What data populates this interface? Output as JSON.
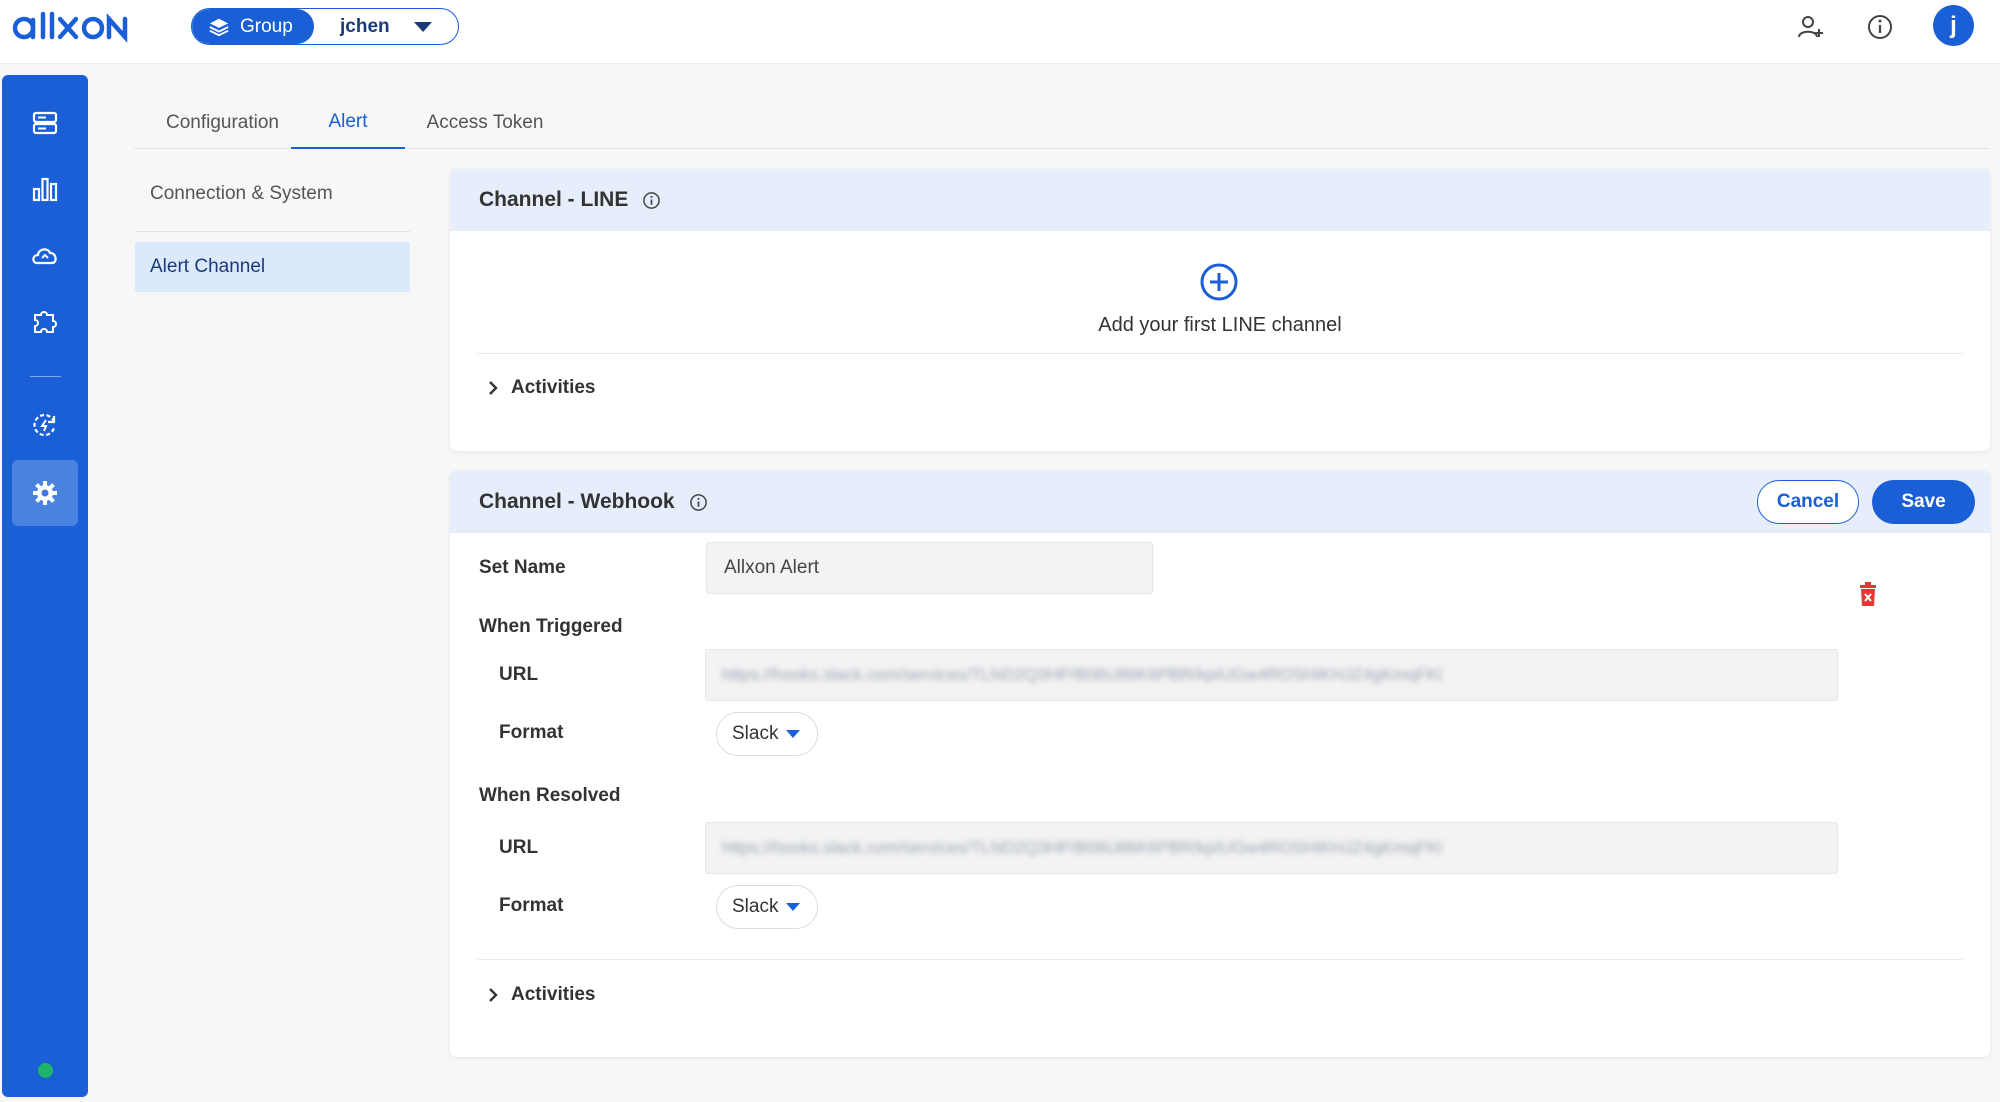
{
  "header": {
    "logo_text": "allxon",
    "group_label": "Group",
    "user_name": "jchen",
    "avatar_letter": "j",
    "icons": [
      "add-user-icon",
      "info-icon"
    ]
  },
  "rail": {
    "icons": [
      "server-icon",
      "bar-chart-icon",
      "cloud-sync-icon",
      "puzzle-icon",
      "refresh-icon",
      "gear-icon"
    ],
    "active": "gear-icon",
    "status_color": "#1fb46a"
  },
  "tabs": [
    {
      "label": "Configuration"
    },
    {
      "label": "Alert"
    },
    {
      "label": "Access Token"
    }
  ],
  "subnav": [
    {
      "label": "Connection & System"
    },
    {
      "label": "Alert Channel"
    }
  ],
  "line_card": {
    "title": "Channel - LINE",
    "add_text": "Add your first LINE channel",
    "activities": "Activities"
  },
  "webhook_card": {
    "title": "Channel - Webhook",
    "cancel": "Cancel",
    "save": "Save",
    "set_name_label": "Set Name",
    "set_name_value": "Allxon Alert",
    "triggered_label": "When Triggered",
    "resolved_label": "When Resolved",
    "url_label": "URL",
    "format_label": "Format",
    "triggered_url": "https://hooks.slack.com/services/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",
    "triggered_format": "Slack",
    "resolved_url": "https://hooks.slack.com/services/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",
    "resolved_format": "Slack",
    "activities": "Activities"
  },
  "colors": {
    "primary": "#1a5fd6",
    "card_header": "#e6eefb",
    "subnav_active": "#dce9fb",
    "delete": "#e53935"
  }
}
